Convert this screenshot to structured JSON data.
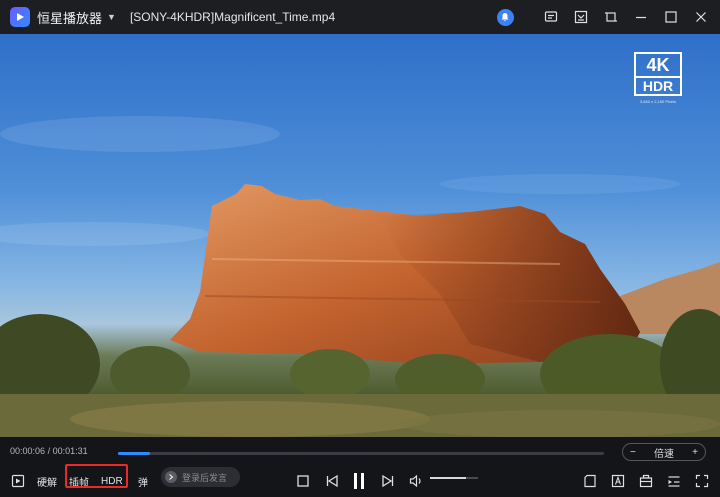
{
  "titlebar": {
    "app_name": "恒星播放器",
    "file_name": "[SONY-4KHDR]Magnificent_Time.mp4"
  },
  "icons": {
    "logo": "play-logo-icon",
    "app_menu": "chevron-down-icon",
    "notify": "bell-icon",
    "subtitle": "subtitle-icon",
    "screenshot": "screenshot-icon",
    "pin": "pin-icon",
    "minimize": "minimize-icon",
    "maximize": "maximize-icon",
    "close": "close-icon"
  },
  "video": {
    "badge_4k": "4K",
    "badge_hdr": "HDR",
    "badge_small": "3,840 x 2,160 Pixels"
  },
  "progress": {
    "current": "00:00:06",
    "total": "00:01:31",
    "fraction": 0.066
  },
  "speed": {
    "minus": "−",
    "label": "倍速",
    "plus": "+"
  },
  "controls": {
    "hw_decode": "硬解",
    "frame_interp": "插帧",
    "hdr": "HDR",
    "danmu": "弹",
    "danmu_placeholder": "登录后发言",
    "volume_fraction": 0.75
  },
  "colors": {
    "accent": "#2f8bff",
    "highlight": "#ea2a2a",
    "bg": "#141519"
  }
}
